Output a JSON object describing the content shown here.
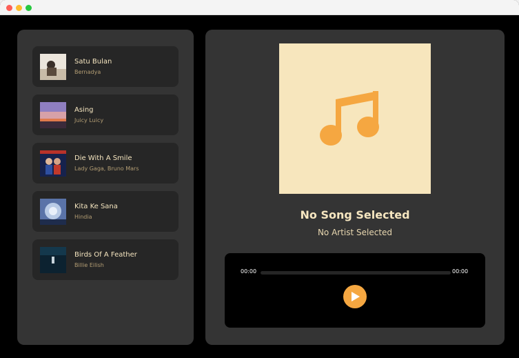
{
  "window": {
    "controls": [
      "close",
      "minimize",
      "maximize"
    ]
  },
  "playlist": [
    {
      "title": "Satu Bulan",
      "artist": "Bernadya",
      "cover_colors": [
        "#e8e0d4",
        "#3a2f28"
      ]
    },
    {
      "title": "Asing",
      "artist": "Juicy Luicy",
      "cover_colors": [
        "#8a7fb5",
        "#d98a6a"
      ]
    },
    {
      "title": "Die With A Smile",
      "artist": "Lady Gaga, Bruno Mars",
      "cover_colors": [
        "#1d2a5a",
        "#c0392b"
      ]
    },
    {
      "title": "Kita Ke Sana",
      "artist": "Hindia",
      "cover_colors": [
        "#9fb4d6",
        "#2c3e66"
      ]
    },
    {
      "title": "Birds Of A Feather",
      "artist": "Billie Eilish",
      "cover_colors": [
        "#0e2a3a",
        "#061620"
      ]
    }
  ],
  "player": {
    "song_title": "No Song Selected",
    "song_artist": "No Artist Selected",
    "artwork_icon": "music-note-icon",
    "current_time": "00:00",
    "duration": "00:00",
    "progress": 0,
    "play_icon": "play-icon"
  },
  "colors": {
    "background": "#000000",
    "panel": "#343434",
    "item": "#262626",
    "accent": "#f5a741",
    "cream": "#f7e6bd",
    "text": "#f6e6c0"
  }
}
